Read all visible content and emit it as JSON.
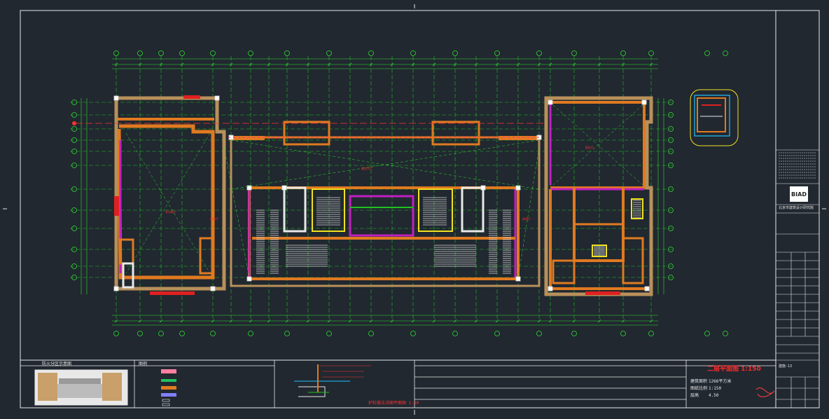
{
  "drawing": {
    "sheet_title": "二层平面图 1:150",
    "logo_text": "BIAD",
    "company_name": "北京市建筑设计研究院",
    "detail_caption": "护栏做法详图平面图 1:30",
    "key_plan_caption": "防火分区示意图",
    "legend_title": "图例",
    "scale_rows": [
      {
        "label": "建筑面积",
        "value": "1266平方米"
      },
      {
        "label": "图纸比例",
        "value": "1:150"
      },
      {
        "label": "层高",
        "value": "4.50"
      }
    ],
    "drawing_number": "建施-13",
    "colors": {
      "background": "#212830",
      "wall_fill": "#e07a20",
      "fire_wall": "#c020c0",
      "gridline": "#20c020",
      "dimension": "#30e030",
      "column": "#ffffff",
      "stair": "#f0e020",
      "annotation": "#ff3030",
      "accent": "#20c0ff"
    }
  }
}
